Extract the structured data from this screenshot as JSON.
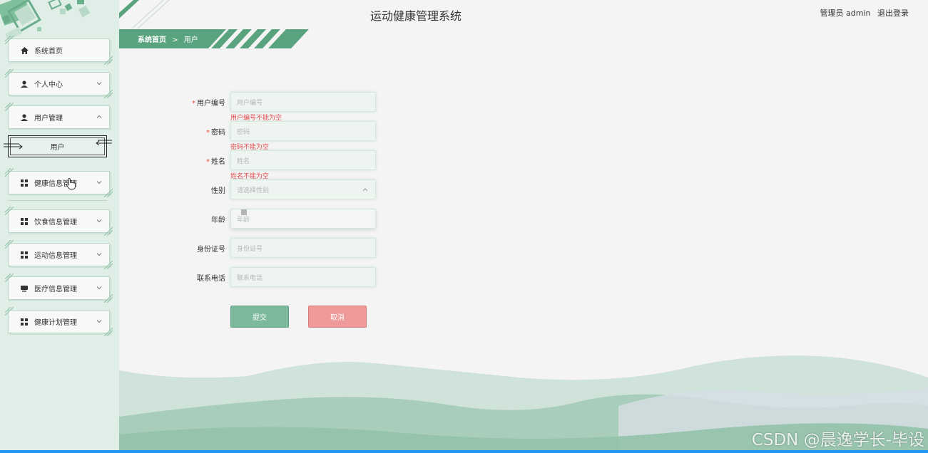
{
  "header": {
    "title": "运动健康管理系统",
    "role": "管理员 admin",
    "logout": "退出登录"
  },
  "breadcrumb": {
    "home": "系统首页",
    "separator": ">",
    "current": "用户"
  },
  "sidebar": {
    "items": [
      {
        "label": "系统首页",
        "icon": "home-icon"
      },
      {
        "label": "个人中心",
        "icon": "person-icon"
      },
      {
        "label": "用户管理",
        "icon": "person-icon"
      },
      {
        "label": "健康信息管理",
        "icon": "grid-icon"
      },
      {
        "label": "饮食信息管理",
        "icon": "grid-icon"
      },
      {
        "label": "运动信息管理",
        "icon": "grid-icon"
      },
      {
        "label": "医疗信息管理",
        "icon": "monitor-icon"
      },
      {
        "label": "健康计划管理",
        "icon": "grid-icon"
      }
    ],
    "sub_item": "用户"
  },
  "form": {
    "fields": [
      {
        "label": "用户编号",
        "placeholder": "用户编号",
        "required": true,
        "error": "用户编号不能为空"
      },
      {
        "label": "密码",
        "placeholder": "密码",
        "required": true,
        "error": "密码不能为空"
      },
      {
        "label": "姓名",
        "placeholder": "姓名",
        "required": true,
        "error": "姓名不能为空"
      },
      {
        "label": "性别",
        "placeholder": "请选择性别",
        "required": false
      },
      {
        "label": "年龄",
        "placeholder": "年龄",
        "required": false
      },
      {
        "label": "身份证号",
        "placeholder": "身份证号",
        "required": false
      },
      {
        "label": "联系电话",
        "placeholder": "联系电话",
        "required": false
      }
    ],
    "submit": "提交",
    "cancel": "取消",
    "required_mark": "*"
  },
  "watermark": "CSDN @晨逸学长-毕设",
  "colors": {
    "accent": "#5aa37f",
    "sidebar_bg": "#dfeee7",
    "error": "#e04c4c",
    "cancel": "#ee9a9a"
  }
}
